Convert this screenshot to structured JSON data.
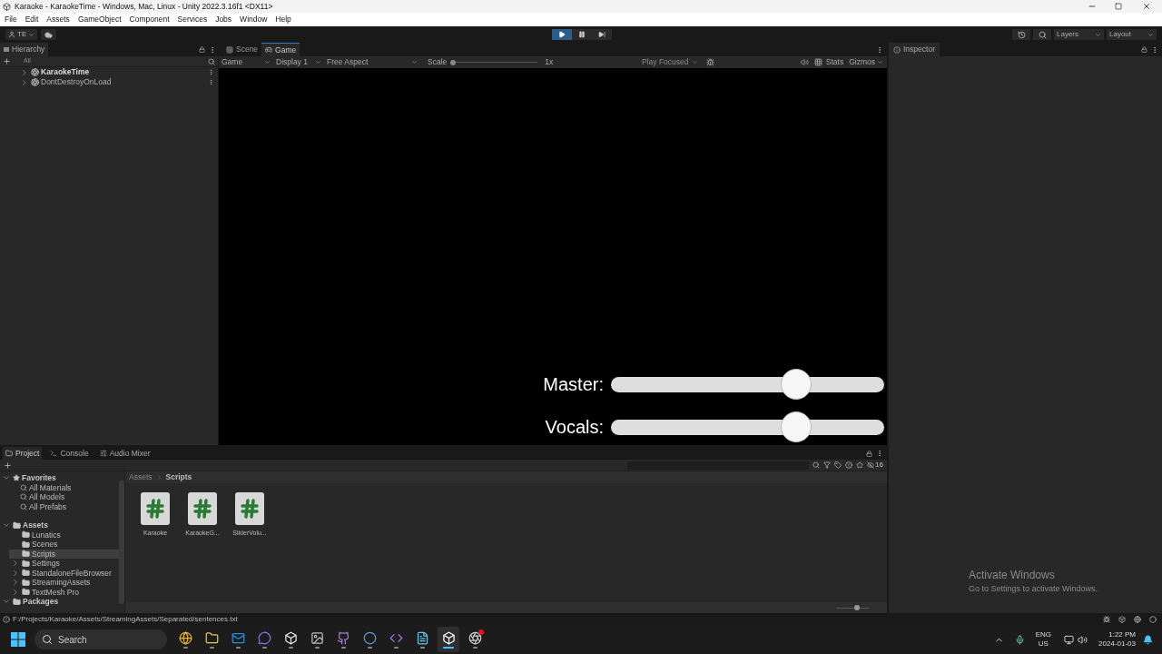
{
  "window": {
    "title": "Karaoke - KaraokeTime - Windows, Mac, Linux - Unity 2022.3.16f1 <DX11>"
  },
  "menu": [
    "File",
    "Edit",
    "Assets",
    "GameObject",
    "Component",
    "Services",
    "Jobs",
    "Window",
    "Help"
  ],
  "toolbar": {
    "account": "TE",
    "play_controls": [
      {
        "kind": "play",
        "selected": true
      },
      {
        "kind": "pause",
        "selected": false
      },
      {
        "kind": "step",
        "selected": false
      }
    ],
    "layers": "Layers",
    "layout": "Layout"
  },
  "hierarchy": {
    "title": "Hierarchy",
    "search_placeholder": "All",
    "items": [
      {
        "label": "KaraokeTime",
        "active": true,
        "expanded": false
      },
      {
        "label": "DontDestroyOnLoad",
        "active": false,
        "expanded": false
      }
    ]
  },
  "game_view": {
    "tabs": [
      {
        "label": "Scene",
        "kind": "scene",
        "selected": false
      },
      {
        "label": "Game",
        "kind": "game",
        "selected": true
      }
    ],
    "toolbar": {
      "mode": "Game",
      "display": "Display 1",
      "aspect": "Free Aspect",
      "scale_label": "Scale",
      "scale_slider": {
        "level": 0
      },
      "scale_value": "1x",
      "play_focused": "Play Focused",
      "stats": "Stats",
      "gizmos": "Gizmos"
    },
    "sliders": [
      {
        "label": "Master:",
        "level": 0.7
      },
      {
        "label": "Vocals:",
        "level": 0.7
      }
    ]
  },
  "inspector": {
    "title": "Inspector"
  },
  "project": {
    "tabs": [
      {
        "label": "Project",
        "kind": "folder",
        "selected": true
      },
      {
        "label": "Console",
        "kind": "console",
        "selected": false
      },
      {
        "label": "Audio Mixer",
        "kind": "mixer",
        "selected": false
      }
    ],
    "hidden_count": "16",
    "favorites": {
      "label": "Favorites",
      "expanded": true,
      "items": [
        "All Materials",
        "All Models",
        "All Prefabs"
      ]
    },
    "tree": [
      {
        "label": "Assets",
        "expanded": true,
        "selected": false,
        "children": [
          {
            "label": "Lunatics",
            "selected": false
          },
          {
            "label": "Scenes",
            "selected": false
          },
          {
            "label": "Scripts",
            "selected": true
          },
          {
            "label": "Settings",
            "expanded": false,
            "selected": false
          },
          {
            "label": "StandaloneFileBrowser",
            "expanded": false,
            "selected": false
          },
          {
            "label": "StreamingAssets",
            "expanded": false,
            "selected": false
          },
          {
            "label": "TextMesh Pro",
            "expanded": false,
            "selected": false
          }
        ]
      },
      {
        "label": "Packages",
        "expanded": true,
        "selected": false
      }
    ],
    "breadcrumb": [
      "Assets",
      "Scripts"
    ],
    "files": [
      "Karaoke",
      "KaraokeG...",
      "SliderVolu..."
    ],
    "icon_size_slider": {
      "level": 0.65
    }
  },
  "activation_notice": {
    "title": "Activate Windows",
    "text": "Go to Settings to activate Windows."
  },
  "status_bar": {
    "message": "F:/Projects/Karaoke/Assets/StreamingAssets/Separated/sentences.txt"
  },
  "taskbar": {
    "search_placeholder": "Search",
    "apps": [
      {
        "kind": "browser",
        "selected": false,
        "notification": false
      },
      {
        "kind": "files",
        "selected": false,
        "notification": false
      },
      {
        "kind": "mail",
        "selected": false,
        "notification": false
      },
      {
        "kind": "chat",
        "selected": false,
        "notification": false
      },
      {
        "kind": "hub",
        "selected": false,
        "notification": false
      },
      {
        "kind": "gallery",
        "selected": false,
        "notification": false
      },
      {
        "kind": "github",
        "selected": false,
        "notification": false
      },
      {
        "kind": "steam",
        "selected": false,
        "notification": false
      },
      {
        "kind": "ide",
        "selected": false,
        "notification": false
      },
      {
        "kind": "notes",
        "selected": false,
        "notification": false
      },
      {
        "kind": "editor",
        "selected": true,
        "notification": false
      },
      {
        "kind": "recorder",
        "selected": false,
        "notification": true
      }
    ],
    "language": "ENG",
    "region": "US",
    "time": "1:22 PM",
    "date": "2024-01-03"
  }
}
